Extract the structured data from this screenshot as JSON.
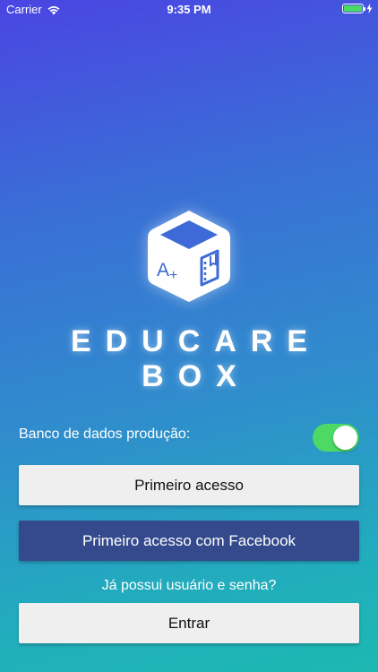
{
  "status_bar": {
    "carrier": "Carrier",
    "time": "9:35 PM",
    "battery_level": 1.0,
    "charging": true,
    "battery_color": "#4cd964"
  },
  "brand": {
    "line1": "EDUCARE",
    "line2": "BOX",
    "logo_icon": "cube-grade-notebook-icon"
  },
  "settings": {
    "db_label": "Banco de dados produção:",
    "db_toggle_on": true,
    "toggle_color": "#4cd964"
  },
  "actions": {
    "first_access": "Primeiro acesso",
    "first_access_facebook": "Primeiro acesso com Facebook",
    "has_account": "Já possui usuário e senha?",
    "enter": "Entrar"
  },
  "colors": {
    "gradient_top": "#4a45e2",
    "gradient_bottom": "#1db8b2",
    "facebook_button": "#344a8c",
    "light_button": "#efefef"
  }
}
